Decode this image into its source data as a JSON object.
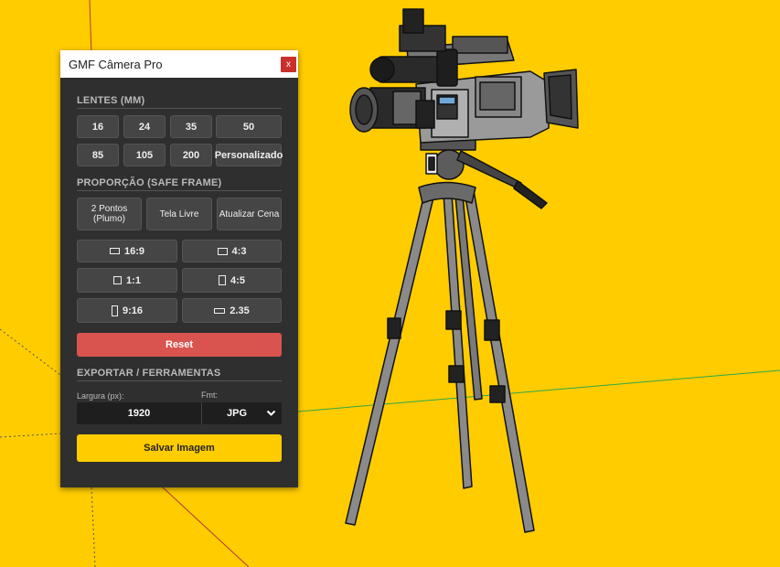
{
  "window": {
    "title": "GMF Câmera Pro",
    "close_label": "x"
  },
  "lenses": {
    "title": "LENTES (MM)",
    "row1": [
      "16",
      "24",
      "35",
      "50"
    ],
    "row2": [
      "85",
      "105",
      "200",
      "Personalizado"
    ]
  },
  "proportion": {
    "title": "PROPORÇÃO (SAFE FRAME)",
    "actions": [
      "2 Pontos (Plumo)",
      "Tela Livre",
      "Atualizar Cena"
    ],
    "ratios": [
      {
        "label": "16:9",
        "icon": "landscape-frame-icon"
      },
      {
        "label": "4:3",
        "icon": "landscape-frame-icon"
      },
      {
        "label": "1:1",
        "icon": "square-frame-icon"
      },
      {
        "label": "4:5",
        "icon": "portrait-frame-icon"
      },
      {
        "label": "9:16",
        "icon": "portrait-frame-icon"
      },
      {
        "label": "2.35",
        "icon": "wide-frame-icon"
      }
    ],
    "reset_label": "Reset"
  },
  "export": {
    "title": "EXPORTAR / FERRAMENTAS",
    "width_label": "Largura (px):",
    "width_value": "1920",
    "format_label": "Fmt:",
    "format_value": "JPG",
    "save_label": "Salvar Imagem"
  },
  "colors": {
    "background": "#FFCC00",
    "panel": "#2f2f2f",
    "reset": "#d9534f",
    "accent": "#FFCC00",
    "close": "#c9302c"
  }
}
